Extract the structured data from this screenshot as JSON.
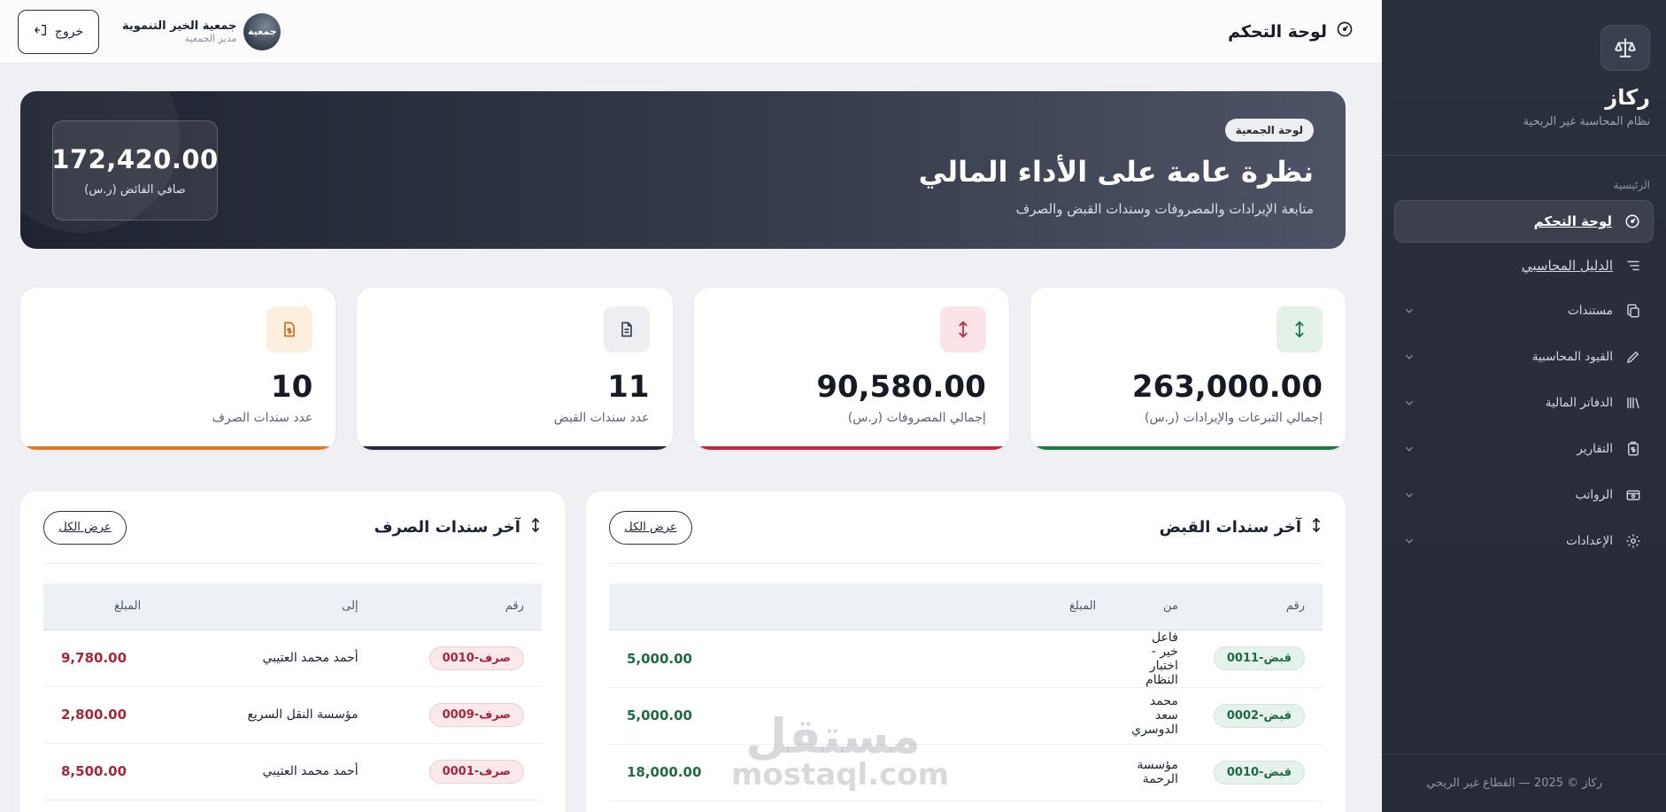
{
  "sidebar": {
    "brand_name": "ركاز",
    "brand_subtitle": "نظام المحاسبة غير الربحية",
    "section_label": "الرئيسية",
    "items": [
      {
        "label": "لوحة التحكم",
        "icon": "gauge-icon",
        "active": true
      },
      {
        "label": "الدليل المحاسبي",
        "icon": "list-tree-icon"
      },
      {
        "label": "مستندات",
        "icon": "copy-icon"
      },
      {
        "label": "القيود المحاسبية",
        "icon": "pencil-icon"
      },
      {
        "label": "الدفاتر المالية",
        "icon": "books-icon"
      },
      {
        "label": "التقارير",
        "icon": "clipboard-dollar-icon"
      },
      {
        "label": "الرواتب",
        "icon": "wallet-icon"
      },
      {
        "label": "الإعدادات",
        "icon": "gear-icon"
      }
    ],
    "footer": "ركاز © 2025 — القطاع غير الربحي"
  },
  "topbar": {
    "title": "لوحة التحكم",
    "logout_label": "خروج",
    "org_name": "جمعية الخير التنموية",
    "org_role": "مدير الجمعية",
    "avatar_text": "جمعية"
  },
  "hero": {
    "pill": "لوحة الجمعية",
    "title": "نظرة عامة على الأداء المالي",
    "subtitle": "متابعة الإيرادات والمصروفات وسندات القبض والصرف",
    "net_value": "172,420.00",
    "net_label": "صافي الفائض (ر.س)"
  },
  "stats": [
    {
      "value": "263,000.00",
      "label": "إجمالي التبرعات والإيرادات (ر.س)",
      "icon": "arrow-up-down-icon",
      "accent": "#1f7a47",
      "icon_bg": "#e3f2e9",
      "icon_color": "#1f7a47"
    },
    {
      "value": "90,580.00",
      "label": "إجمالي المصروفات (ر.س)",
      "icon": "arrow-up-down-icon",
      "accent": "#c42a3e",
      "icon_bg": "#fbe4e7",
      "icon_color": "#c42a3e"
    },
    {
      "value": "11",
      "label": "عدد سندات القبض",
      "icon": "document-icon",
      "accent": "#262b38",
      "icon_bg": "#eceef2",
      "icon_color": "#3a4050"
    },
    {
      "value": "10",
      "label": "عدد سندات الصرف",
      "icon": "dollar-file-icon",
      "accent": "#e07d22",
      "icon_bg": "#fdeedd",
      "icon_color": "#c8741f"
    }
  ],
  "receipts": {
    "title": "آخر سندات القبض",
    "view_all": "عرض الكل",
    "headers": {
      "number": "رقم",
      "from": "من",
      "amount": "المبلغ"
    },
    "rows": [
      {
        "number": "قبض-0011",
        "party": "فاعل خير - اختبار النظام",
        "amount": "5,000.00"
      },
      {
        "number": "قبض-0002",
        "party": "محمد سعد الدوسري",
        "amount": "5,000.00"
      },
      {
        "number": "قبض-0010",
        "party": "مؤسسة الرحمة",
        "amount": "18,000.00"
      }
    ]
  },
  "payments": {
    "title": "آخر سندات الصرف",
    "view_all": "عرض الكل",
    "headers": {
      "number": "رقم",
      "to": "إلى",
      "amount": "المبلغ"
    },
    "rows": [
      {
        "number": "صرف-0010",
        "party": "أحمد محمد العتيبي",
        "amount": "9,780.00"
      },
      {
        "number": "صرف-0009",
        "party": "مؤسسة النقل السريع",
        "amount": "2,800.00"
      },
      {
        "number": "صرف-0001",
        "party": "أحمد محمد العتيبي",
        "amount": "8,500.00"
      }
    ]
  },
  "watermark": {
    "ar": "مستقل",
    "en": "mostaql.com"
  }
}
